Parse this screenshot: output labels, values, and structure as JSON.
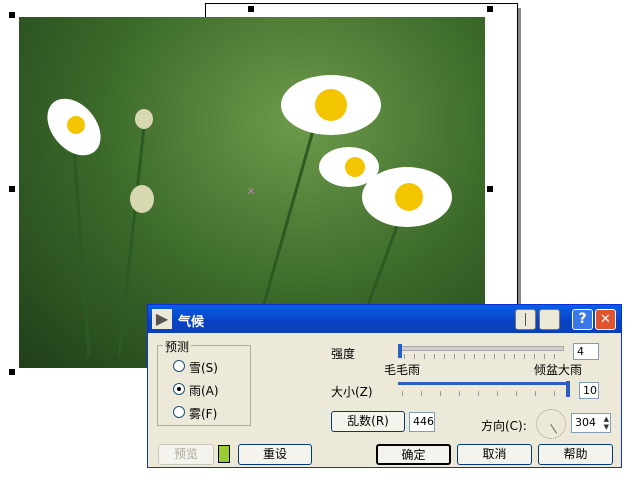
{
  "dialog": {
    "title": "气候",
    "help_symbol": "?",
    "close_symbol": "✕",
    "forecast_group": {
      "label": "预测",
      "options": [
        {
          "label": "雪(S)",
          "selected": false
        },
        {
          "label": "雨(A)",
          "selected": true
        },
        {
          "label": "雾(F)",
          "selected": false
        }
      ]
    },
    "intensity": {
      "label": "强度",
      "value": "4",
      "min_label": "毛毛雨",
      "max_label": "倾盆大雨"
    },
    "size": {
      "label": "大小(Z)",
      "value": "10"
    },
    "random": {
      "button": "乱数(R)",
      "value": "446"
    },
    "direction": {
      "label": "方向(C):",
      "value": "304"
    },
    "buttons": {
      "preview": "预览",
      "reset": "重设",
      "ok": "确定",
      "cancel": "取消",
      "help": "帮助"
    }
  },
  "colors": {
    "title_bar": "#0842c4",
    "dialog_bg": "#ece9d8",
    "close": "#e0532f"
  }
}
